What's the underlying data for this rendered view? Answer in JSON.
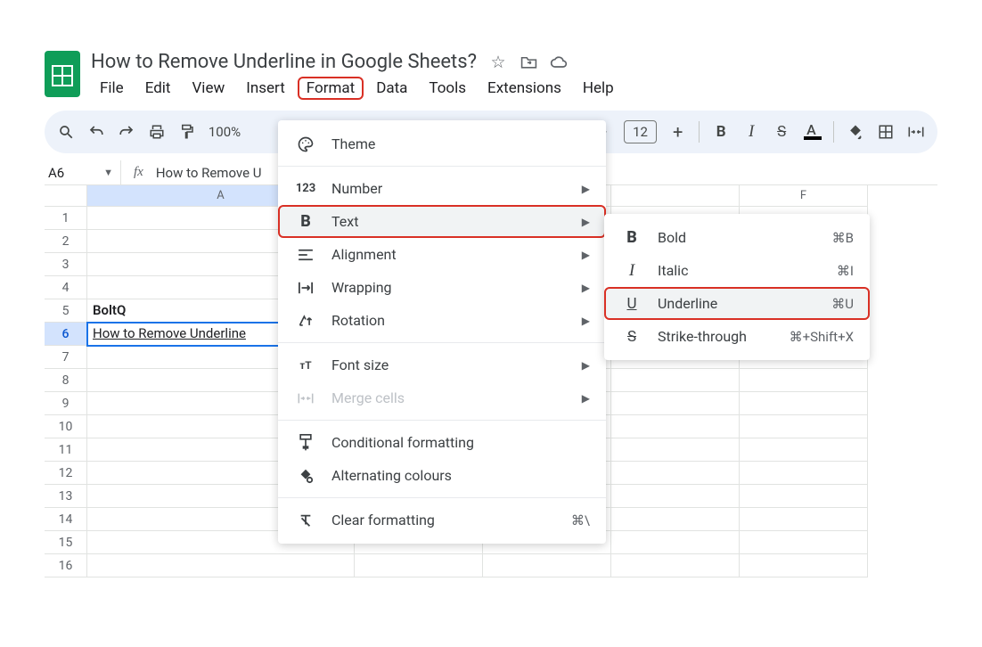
{
  "doc": {
    "title": "How to Remove Underline in Google Sheets?"
  },
  "menubar": {
    "file": "File",
    "edit": "Edit",
    "view": "View",
    "insert": "Insert",
    "format": "Format",
    "data": "Data",
    "tools": "Tools",
    "extensions": "Extensions",
    "help": "Help"
  },
  "toolbar": {
    "zoom": "100%",
    "font_size": "12"
  },
  "namebox": {
    "ref": "A6",
    "formula": "How to Remove U"
  },
  "columns": [
    "A",
    "F"
  ],
  "rows": {
    "labels": [
      "1",
      "2",
      "3",
      "4",
      "5",
      "6",
      "7",
      "8",
      "9",
      "10",
      "11",
      "12",
      "13",
      "14",
      "15",
      "16"
    ],
    "r5_a": "BoltQ",
    "r6_a": "How to Remove Underline"
  },
  "format_menu": {
    "theme": "Theme",
    "number": "Number",
    "text": "Text",
    "alignment": "Alignment",
    "wrapping": "Wrapping",
    "rotation": "Rotation",
    "font_size": "Font size",
    "merge_cells": "Merge cells",
    "conditional": "Conditional formatting",
    "alt_colours": "Alternating colours",
    "clear": "Clear formatting",
    "clear_shortcut": "⌘\\"
  },
  "text_submenu": {
    "bold": "Bold",
    "bold_shortcut": "⌘B",
    "italic": "Italic",
    "italic_shortcut": "⌘I",
    "underline": "Underline",
    "underline_shortcut": "⌘U",
    "strike": "Strike-through",
    "strike_shortcut": "⌘+Shift+X"
  }
}
